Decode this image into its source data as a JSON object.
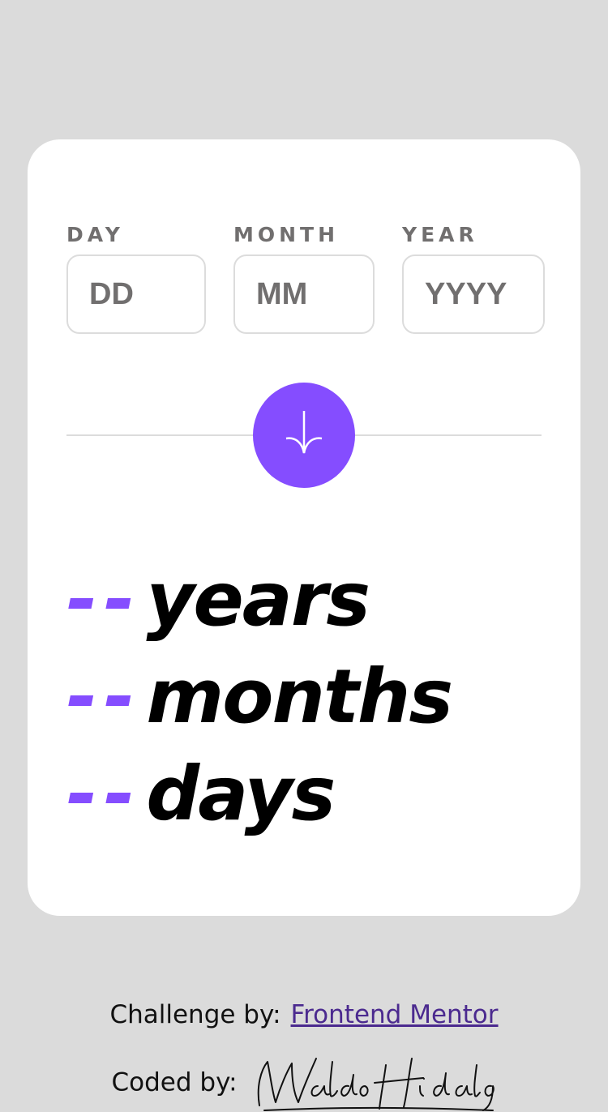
{
  "form": {
    "day": {
      "label": "DAY",
      "placeholder": "DD"
    },
    "month": {
      "label": "MONTH",
      "placeholder": "MM"
    },
    "year": {
      "label": "YEAR",
      "placeholder": "YYYY"
    },
    "submit_icon": "arrow-down-icon"
  },
  "results": [
    {
      "value": "--",
      "unit": "years"
    },
    {
      "value": "--",
      "unit": "months"
    },
    {
      "value": "--",
      "unit": "days"
    }
  ],
  "attribution": {
    "challenge_prefix": "Challenge by:",
    "challenge_link": "Frontend Mentor",
    "coded_prefix": "Coded by:",
    "signature": "Waldo Hidalgo."
  },
  "colors": {
    "accent": "#854dff",
    "background": "#dbdbdb",
    "card": "#ffffff",
    "label": "#716f6f",
    "border": "#dcdcdc",
    "link": "#4b2a8f"
  }
}
